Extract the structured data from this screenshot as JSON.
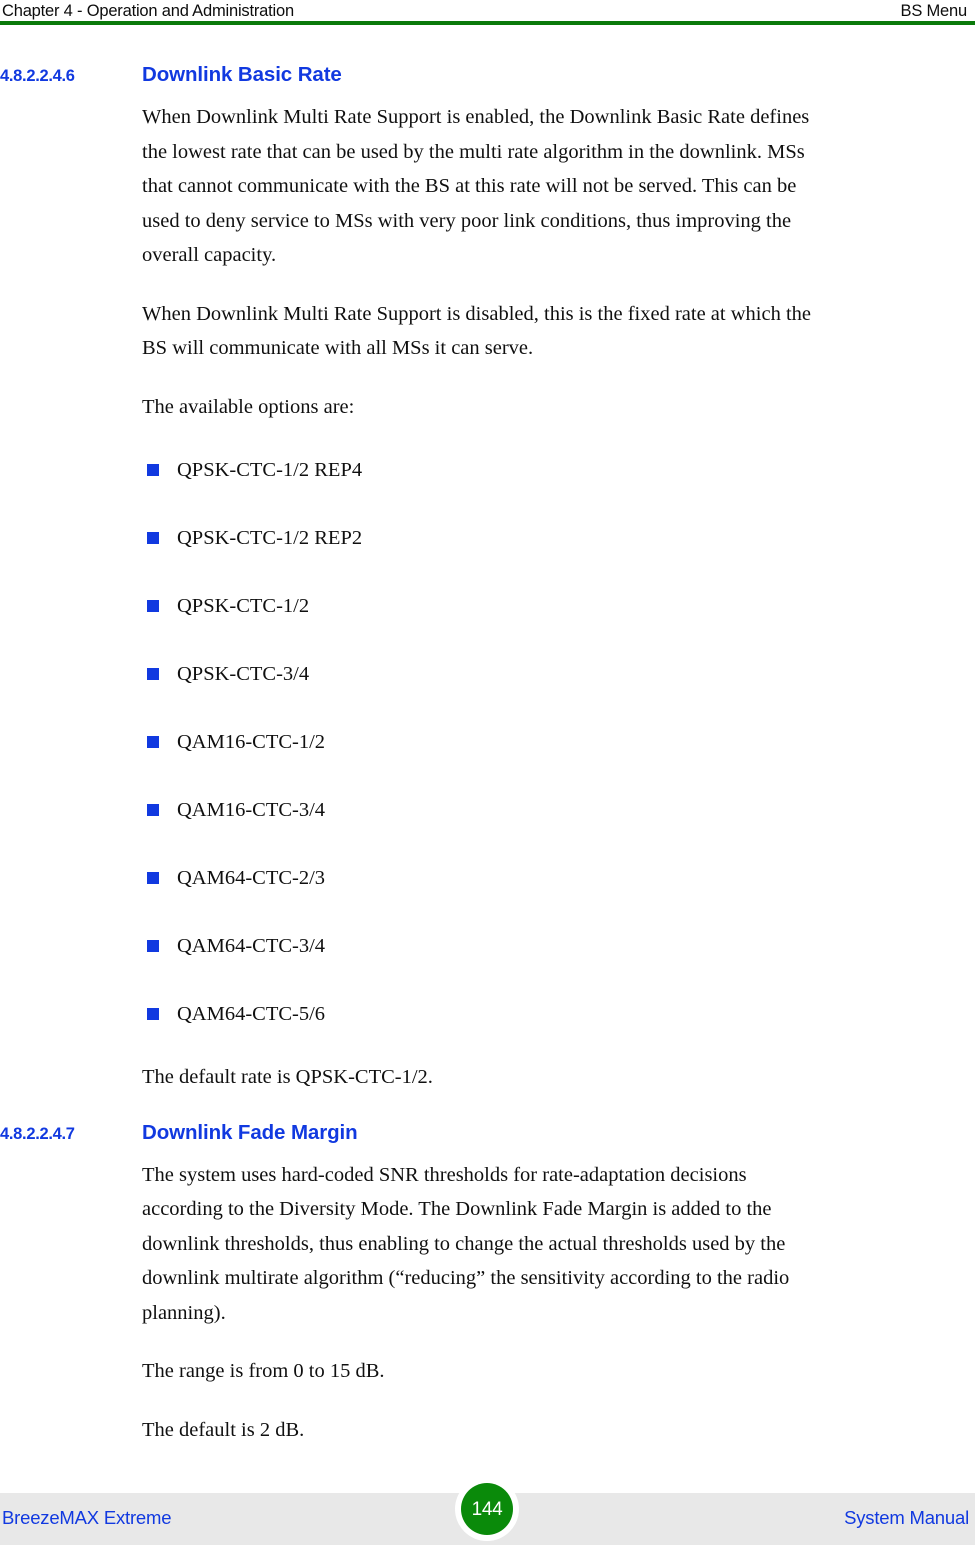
{
  "header": {
    "left": "Chapter 4 - Operation and Administration",
    "right": "BS Menu",
    "rule_color": "#0a7a0a"
  },
  "colors": {
    "heading_blue": "#1139e0",
    "bullet_blue": "#1139e0",
    "footer_band": "#e8e8e8",
    "badge_green": "#0a8a0a",
    "body_text": "#101010"
  },
  "sections": [
    {
      "number": "4.8.2.2.4.6",
      "title": "Downlink Basic Rate",
      "paragraphs": [
        "When Downlink Multi Rate Support is enabled, the Downlink Basic Rate defines the lowest rate that can be used by the multi rate algorithm in the downlink. MSs that cannot communicate with the BS at this rate will not be served. This can be used to deny service to MSs with very poor link conditions, thus improving the overall capacity.",
        "When Downlink Multi Rate Support is disabled, this is the fixed rate at which the BS will communicate with all MSs it can serve.",
        "The available options are:"
      ],
      "options": [
        "QPSK-CTC-1/2 REP4",
        "QPSK-CTC-1/2 REP2",
        "QPSK-CTC-1/2",
        "QPSK-CTC-3/4",
        "QAM16-CTC-1/2",
        "QAM16-CTC-3/4",
        "QAM64-CTC-2/3",
        "QAM64-CTC-3/4",
        "QAM64-CTC-5/6"
      ],
      "closing": "The default rate is QPSK-CTC-1/2."
    },
    {
      "number": "4.8.2.2.4.7",
      "title": "Downlink Fade Margin",
      "paragraphs": [
        "The system uses hard-coded SNR thresholds for rate-adaptation decisions according to the Diversity Mode. The Downlink Fade Margin is added to the downlink thresholds, thus enabling to change the actual thresholds used by the downlink multirate algorithm (“reducing” the sensitivity according to the radio planning).",
        "The range is from 0 to 15 dB.",
        "The default is 2 dB."
      ]
    }
  ],
  "footer": {
    "left": "BreezeMAX Extreme",
    "right": "System Manual",
    "page_number": "144"
  }
}
